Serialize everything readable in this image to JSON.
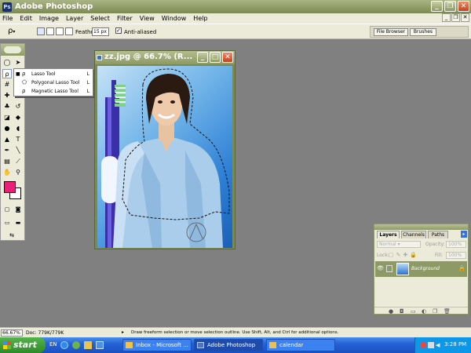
{
  "app": {
    "title": "Adobe Photoshop",
    "icon": "photoshop-icon"
  },
  "menubar": {
    "items": [
      "File",
      "Edit",
      "Image",
      "Layer",
      "Select",
      "Filter",
      "View",
      "Window",
      "Help"
    ]
  },
  "options_bar": {
    "feather_label": "Feather:",
    "feather_value": "15 px",
    "anti_aliased_label": "Anti-aliased",
    "anti_aliased_checked": true,
    "palette_tabs": [
      "File Browser",
      "Brushes"
    ]
  },
  "flyout": {
    "items": [
      {
        "name": "Lasso Tool",
        "key": "L",
        "selected": true
      },
      {
        "name": "Polygonal Lasso Tool",
        "key": "L",
        "selected": false
      },
      {
        "name": "Magnetic Lasso Tool",
        "key": "L",
        "selected": false
      }
    ]
  },
  "colors": {
    "foreground": "#e8207a",
    "background": "#ffffff",
    "accent_titlebar": "#8d9a64"
  },
  "document": {
    "title": "zz.jpg @ 66.7% (R..."
  },
  "layers": {
    "tabs": [
      "Layers",
      "Channels",
      "Paths"
    ],
    "blend_mode": "Normal",
    "opacity_label": "Opacity:",
    "opacity_value": "100%",
    "lock_label": "Lock:",
    "fill_label": "Fill:",
    "fill_value": "100%",
    "layer_name": "Background"
  },
  "status": {
    "zoom": "66.67%",
    "doc_info": "Doc: 779K/779K",
    "hint": "Draw freeform selection or move selection outline.  Use Shift, Alt, and Ctrl for additional options."
  },
  "taskbar": {
    "start_label": "start",
    "language": "EN",
    "buttons": [
      {
        "label": "Inbox - Microsoft ...",
        "active": false
      },
      {
        "label": "Adobe Photoshop",
        "active": true
      },
      {
        "label": "calendar",
        "active": false
      }
    ],
    "clock": "3:28 PM"
  }
}
